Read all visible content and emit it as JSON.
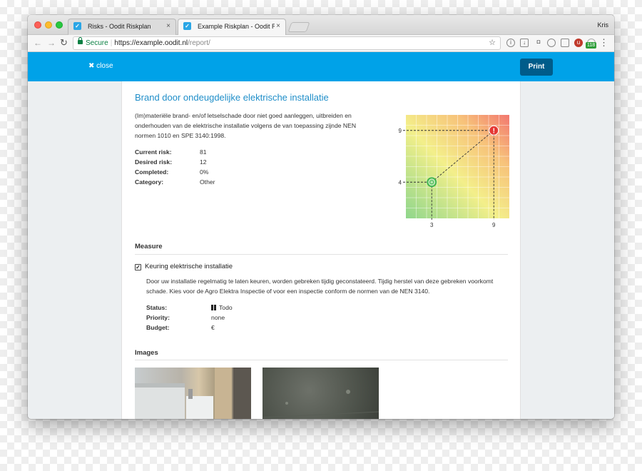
{
  "browser": {
    "tabs": [
      {
        "label": "Risks - Oodit Riskplan",
        "active": false
      },
      {
        "label": "Example Riskplan - Oodit Riskp",
        "active": true
      }
    ],
    "profile": "Kris",
    "secure_label": "Secure",
    "url_host": "https://example.oodit.nl",
    "url_path": "/report/",
    "extension_badge": "118"
  },
  "topbar": {
    "close_label": "close",
    "print_label": "Print",
    "color": "#00a2e8"
  },
  "risk": {
    "title": "Brand door ondeugdelijke elektrische installatie",
    "description": "(Im)materiële brand- en/of letselschade door niet goed aanleggen, uitbreiden en onderhouden van de elektrische installatie volgens de van toepassing zijnde NEN normen 1010 en SPE 3140:1998.",
    "facts": [
      {
        "label": "Current risk:",
        "value": "81"
      },
      {
        "label": "Desired risk:",
        "value": "12"
      },
      {
        "label": "Completed:",
        "value": "0%"
      },
      {
        "label": "Category:",
        "value": "Other"
      }
    ]
  },
  "chart_data": {
    "type": "scatter",
    "x_range": [
      1,
      10
    ],
    "y_range": [
      1,
      10
    ],
    "points": [
      {
        "x": 3,
        "y": 4,
        "kind": "desired",
        "color": "#3bb34a"
      },
      {
        "x": 9,
        "y": 9,
        "kind": "current",
        "color": "#e53935"
      }
    ],
    "x_ticks": [
      "3",
      "9"
    ],
    "y_ticks": [
      "9",
      "4"
    ],
    "grid": true
  },
  "measure_section": {
    "title": "Measure",
    "item_title": "Keuring elektrische installatie",
    "checked": true,
    "description": "Door uw installatie regelmatig te laten keuren, worden gebreken tijdig geconstateerd. Tijdig herstel van deze gebreken voorkomt schade. Kies voor de Agro Elektra Inspectie of voor een inspectie conform de normen van de NEN 3140.",
    "facts": [
      {
        "label": "Status:",
        "value": "Todo"
      },
      {
        "label": "Priority:",
        "value": "none"
      },
      {
        "label": "Budget:",
        "value": "€"
      }
    ]
  },
  "images_section": {
    "title": "Images"
  }
}
